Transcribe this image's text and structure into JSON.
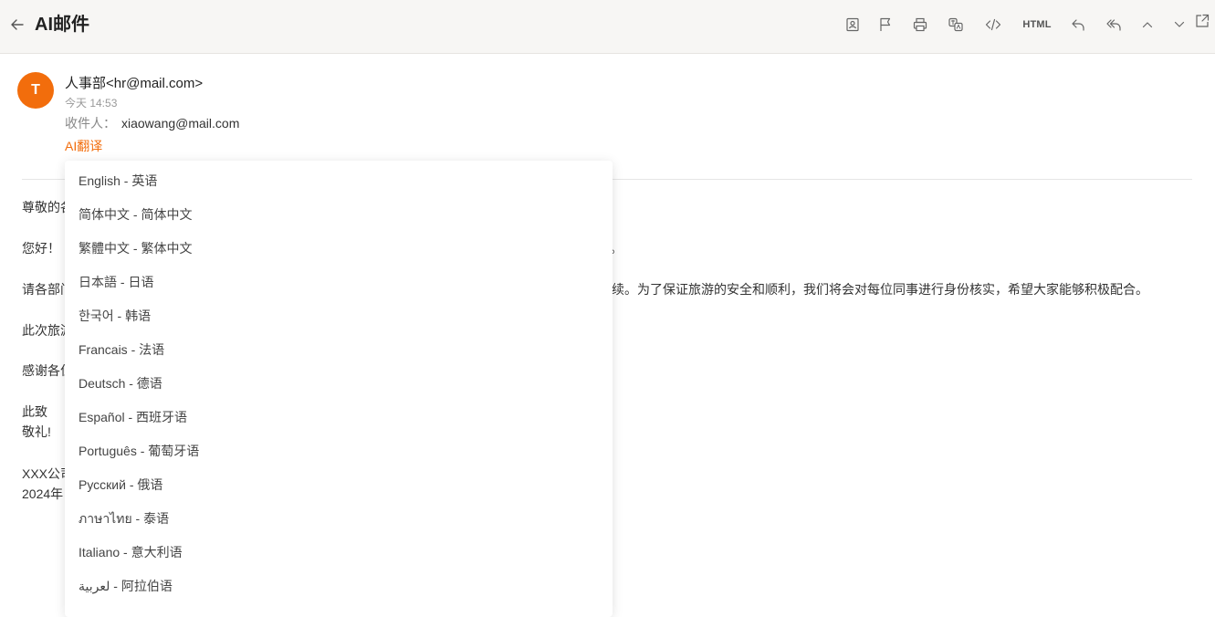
{
  "header": {
    "title": "AI邮件",
    "html_label": "HTML"
  },
  "email": {
    "avatar_letter": "T",
    "sender": "人事部<hr@mail.com>",
    "time": "今天 14:53",
    "recipient_label": "收件人：",
    "recipient": "xiaowang@mail.com",
    "ai_translate": "AI翻译",
    "body": {
      "greeting": "尊敬的各",
      "line1_start": "您好！",
      "line1_end": "。",
      "line2_start": "请各部门",
      "line2_end": "续。为了保证旅游的安全和顺利，我们将会对每位同事进行身份核实，希望大家能够积极配合。",
      "line3_start": "此次旅游",
      "line4_start": "感谢各位",
      "closing1": "此致",
      "closing2": "敬礼!",
      "sign_company": "XXX公司",
      "sign_date": "2024年"
    }
  },
  "language_menu": [
    "English - 英语",
    "简体中文 - 简体中文",
    "繁體中文 - 繁体中文",
    "日本語 - 日语",
    "한국어 - 韩语",
    "Francais - 法语",
    "Deutsch - 德语",
    "Español - 西班牙语",
    "Português - 葡萄牙语",
    "Русский - 俄语",
    "ภาษาไทย - 泰语",
    "Italiano - 意大利语",
    "لعربية - 阿拉伯语"
  ],
  "colors": {
    "accent": "#f26d0c",
    "header_bg": "#f7f6f4"
  }
}
